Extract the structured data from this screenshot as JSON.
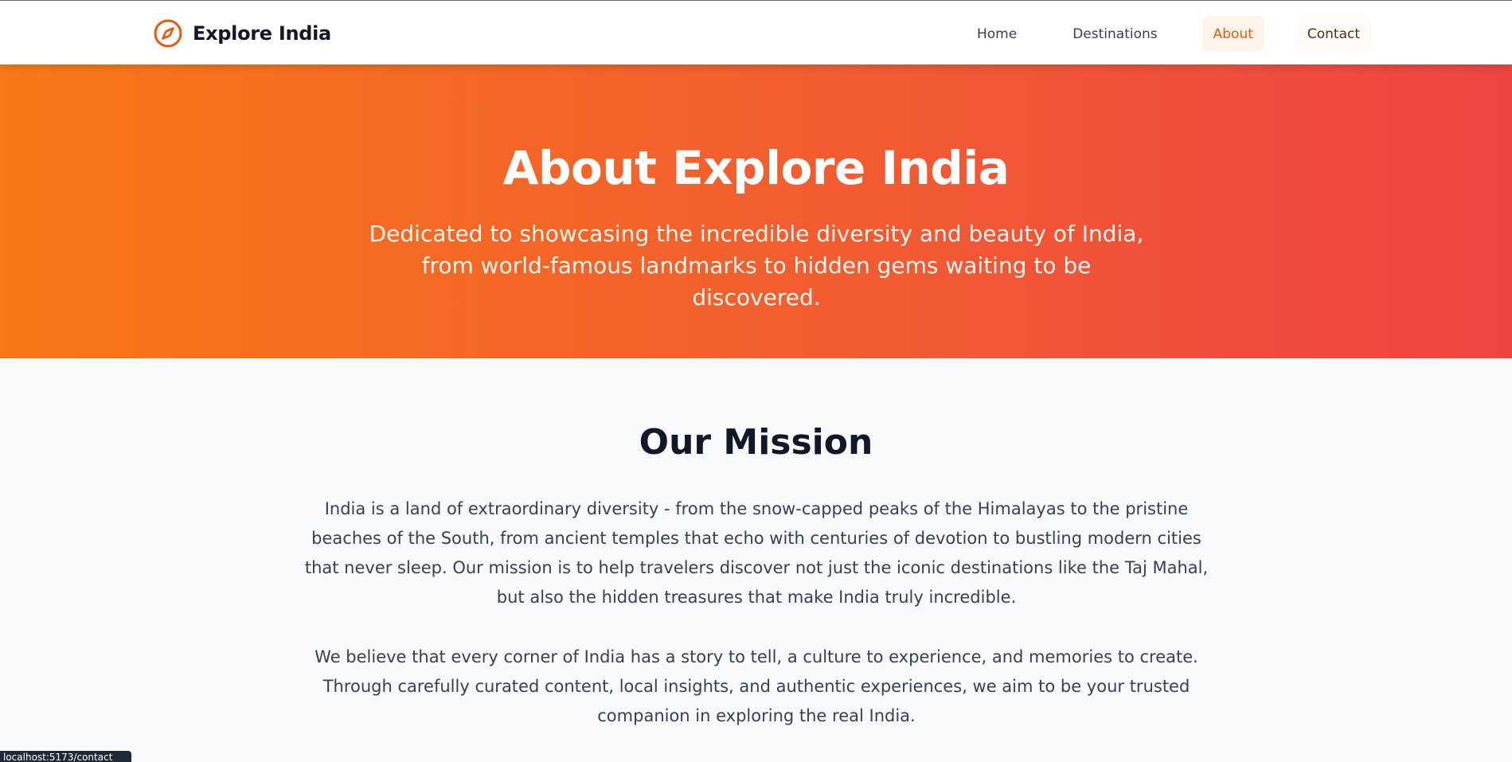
{
  "header": {
    "brand": {
      "icon": "compass-icon",
      "title": "Explore India"
    },
    "nav": [
      {
        "label": "Home",
        "active": false
      },
      {
        "label": "Destinations",
        "active": false
      },
      {
        "label": "About",
        "active": true
      },
      {
        "label": "Contact",
        "active": false
      }
    ]
  },
  "hero": {
    "title": "About Explore India",
    "subtitle": "Dedicated to showcasing the incredible diversity and beauty of India, from world-famous landmarks to hidden gems waiting to be discovered."
  },
  "mission": {
    "title": "Our Mission",
    "paragraphs": [
      "India is a land of extraordinary diversity - from the snow-capped peaks of the Himalayas to the pristine beaches of the South, from ancient temples that echo with centuries of devotion to bustling modern cities that never sleep. Our mission is to help travelers discover not just the iconic destinations like the Taj Mahal, but also the hidden treasures that make India truly incredible.",
      "We believe that every corner of India has a story to tell, a culture to experience, and memories to create. Through carefully curated content, local insights, and authentic experiences, we aim to be your trusted companion in exploring the real India."
    ]
  },
  "status_bar": {
    "url": "localhost:5173/contact"
  },
  "colors": {
    "accent": "#ea580c",
    "hero_gradient_start": "#f97716",
    "hero_gradient_end": "#ef4444",
    "text_dark": "#111827",
    "text_body": "#374151",
    "section_bg": "#f8f9fb"
  }
}
